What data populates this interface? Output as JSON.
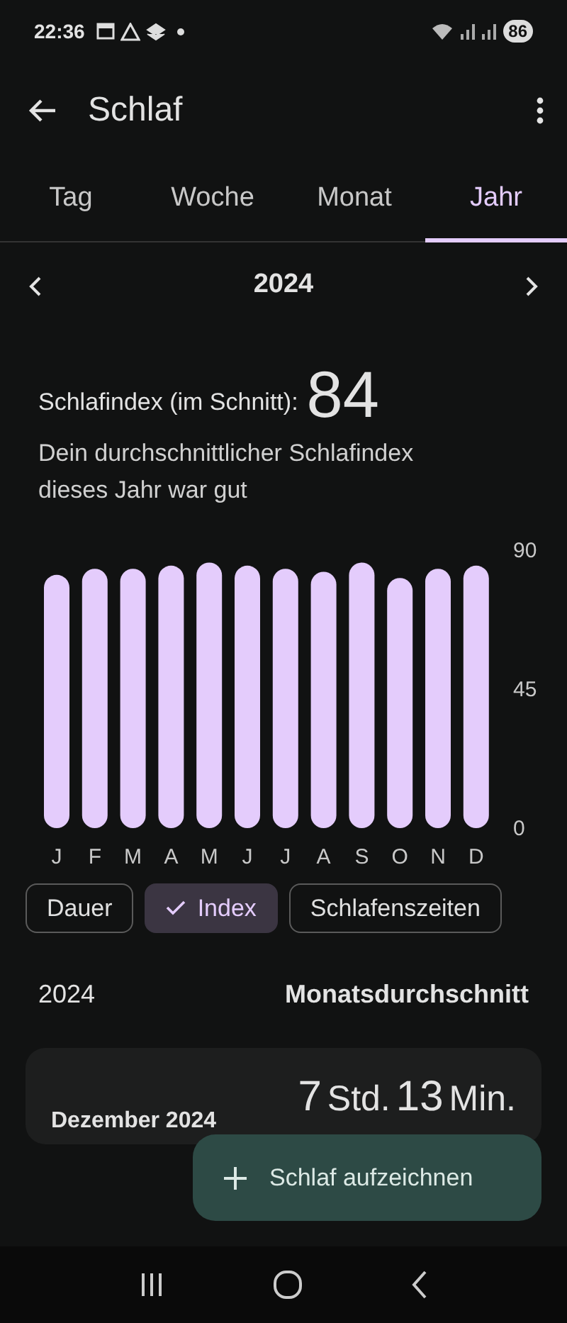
{
  "status_bar": {
    "time": "22:36",
    "battery": "86"
  },
  "app_bar": {
    "title": "Schlaf"
  },
  "tabs": [
    {
      "label": "Tag",
      "selected": false
    },
    {
      "label": "Woche",
      "selected": false
    },
    {
      "label": "Monat",
      "selected": false
    },
    {
      "label": "Jahr",
      "selected": true
    }
  ],
  "period": {
    "label": "2024"
  },
  "summary": {
    "label": "Schlafindex (im Schnitt):",
    "value": "84",
    "description": "Dein durchschnittlicher Schlafindex dieses Jahr war gut"
  },
  "chart_data": {
    "type": "bar",
    "categories": [
      "J",
      "F",
      "M",
      "A",
      "M",
      "J",
      "J",
      "A",
      "S",
      "O",
      "N",
      "D"
    ],
    "series": [
      {
        "color": "#e4ccfc",
        "values": [
          82,
          84,
          84,
          85,
          86,
          85,
          84,
          83,
          86,
          81,
          84,
          85
        ]
      }
    ],
    "ylim": [
      0,
      90
    ],
    "yticks": [
      0,
      45,
      90
    ]
  },
  "chips": [
    {
      "label": "Dauer",
      "selected": false
    },
    {
      "label": "Index",
      "selected": true
    },
    {
      "label": "Schlafenszeiten",
      "selected": false
    }
  ],
  "section": {
    "year": "2024",
    "title": "Monatsdurchschnitt"
  },
  "cards": [
    {
      "month": "Dezember 2024",
      "duration": [
        {
          "text": "7",
          "kind": "number"
        },
        {
          "text": "Std.",
          "kind": "unit"
        },
        {
          "text": "13",
          "kind": "number"
        },
        {
          "text": "Min.",
          "kind": "unit"
        }
      ]
    }
  ],
  "fab": {
    "label": "Schlaf aufzeichnen"
  }
}
